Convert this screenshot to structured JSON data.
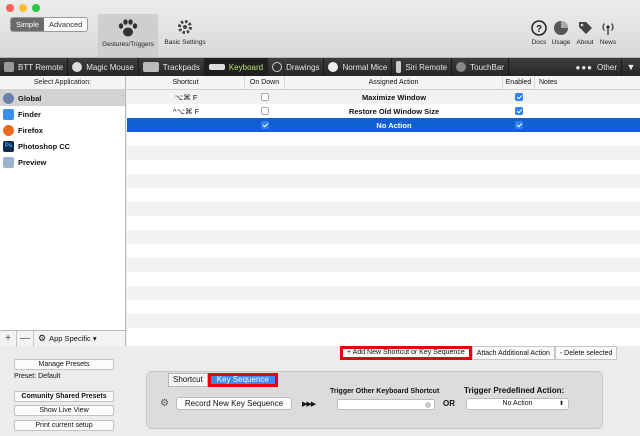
{
  "window": {
    "traffic_colors": [
      "#fc5f57",
      "#fdbc2e",
      "#28c840"
    ]
  },
  "toolbar": {
    "mode_simple": "Simple",
    "mode_advanced": "Advanced",
    "gestures_label": "Gestures/Triggers",
    "basic_settings_label": "Basic Settings",
    "docs_label": "Docs",
    "usage_label": "Usage",
    "about_label": "About",
    "news_label": "News"
  },
  "categories": [
    {
      "label": "BTT Remote",
      "icon": "remote-icon",
      "active": false
    },
    {
      "label": "Magic Mouse",
      "icon": "mouse-icon",
      "active": false
    },
    {
      "label": "Trackpads",
      "icon": "trackpad-icon",
      "active": false
    },
    {
      "label": "Keyboard",
      "icon": "keyboard-icon",
      "active": true
    },
    {
      "label": "Drawings",
      "icon": "drawing-icon",
      "active": false
    },
    {
      "label": "Normal Mice",
      "icon": "normal-mouse-icon",
      "active": false
    },
    {
      "label": "Siri Remote",
      "icon": "siri-remote-icon",
      "active": false
    },
    {
      "label": "TouchBar",
      "icon": "touchbar-icon",
      "active": false
    },
    {
      "label": "Other",
      "icon": "more-dots-icon",
      "active": false
    }
  ],
  "sidebar": {
    "header": "Select Application:",
    "apps": [
      {
        "name": "Global",
        "color": "#6b7fa8",
        "selected": true
      },
      {
        "name": "Finder",
        "color": "#3a90e8",
        "selected": false
      },
      {
        "name": "Firefox",
        "color": "#e86b1f",
        "selected": false
      },
      {
        "name": "Photoshop CC",
        "color": "#0f2b4a",
        "selected": false
      },
      {
        "name": "Preview",
        "color": "#9ab4d0",
        "selected": false
      }
    ],
    "add_label": "+",
    "remove_label": "—",
    "app_specific_label": "App Specific ▾"
  },
  "table": {
    "columns": [
      "Shortcut",
      "On Down",
      "Assigned Action",
      "Enabled",
      "Notes"
    ],
    "rows": [
      {
        "shortcut": "⌥⌘ F",
        "on_down": false,
        "action": "Maximize Window",
        "enabled": true,
        "notes": "",
        "selected": false
      },
      {
        "shortcut": "^⌥⌘ F",
        "on_down": false,
        "action": "Restore Old Window Size",
        "enabled": true,
        "notes": "",
        "selected": false
      },
      {
        "shortcut": "",
        "on_down": true,
        "action": "No Action",
        "enabled": true,
        "notes": "",
        "selected": true
      }
    ],
    "empty_rows": 14
  },
  "table_actions": {
    "add_label": "+ Add New Shortcut or Key Sequence",
    "attach_label": "Attach Additional Action",
    "delete_label": "- Delete selected"
  },
  "presets": {
    "manage_label": "Manage Presets",
    "preset_text": "Preset: Default",
    "community_label": "Comunity Shared Presets",
    "live_view_label": "Show Live View",
    "print_label": "Print current setup"
  },
  "config": {
    "seg_shortcut": "Shortcut",
    "seg_key_sequence": "Key Sequence",
    "record_label": "Record New Key Sequence",
    "arrows": "▶▶▶",
    "trigger_other_label": "Trigger Other Keyboard Shortcut",
    "or_label": "OR",
    "trigger_predefined_label": "Trigger Predefined Action:",
    "predefined_value": "No Action"
  }
}
